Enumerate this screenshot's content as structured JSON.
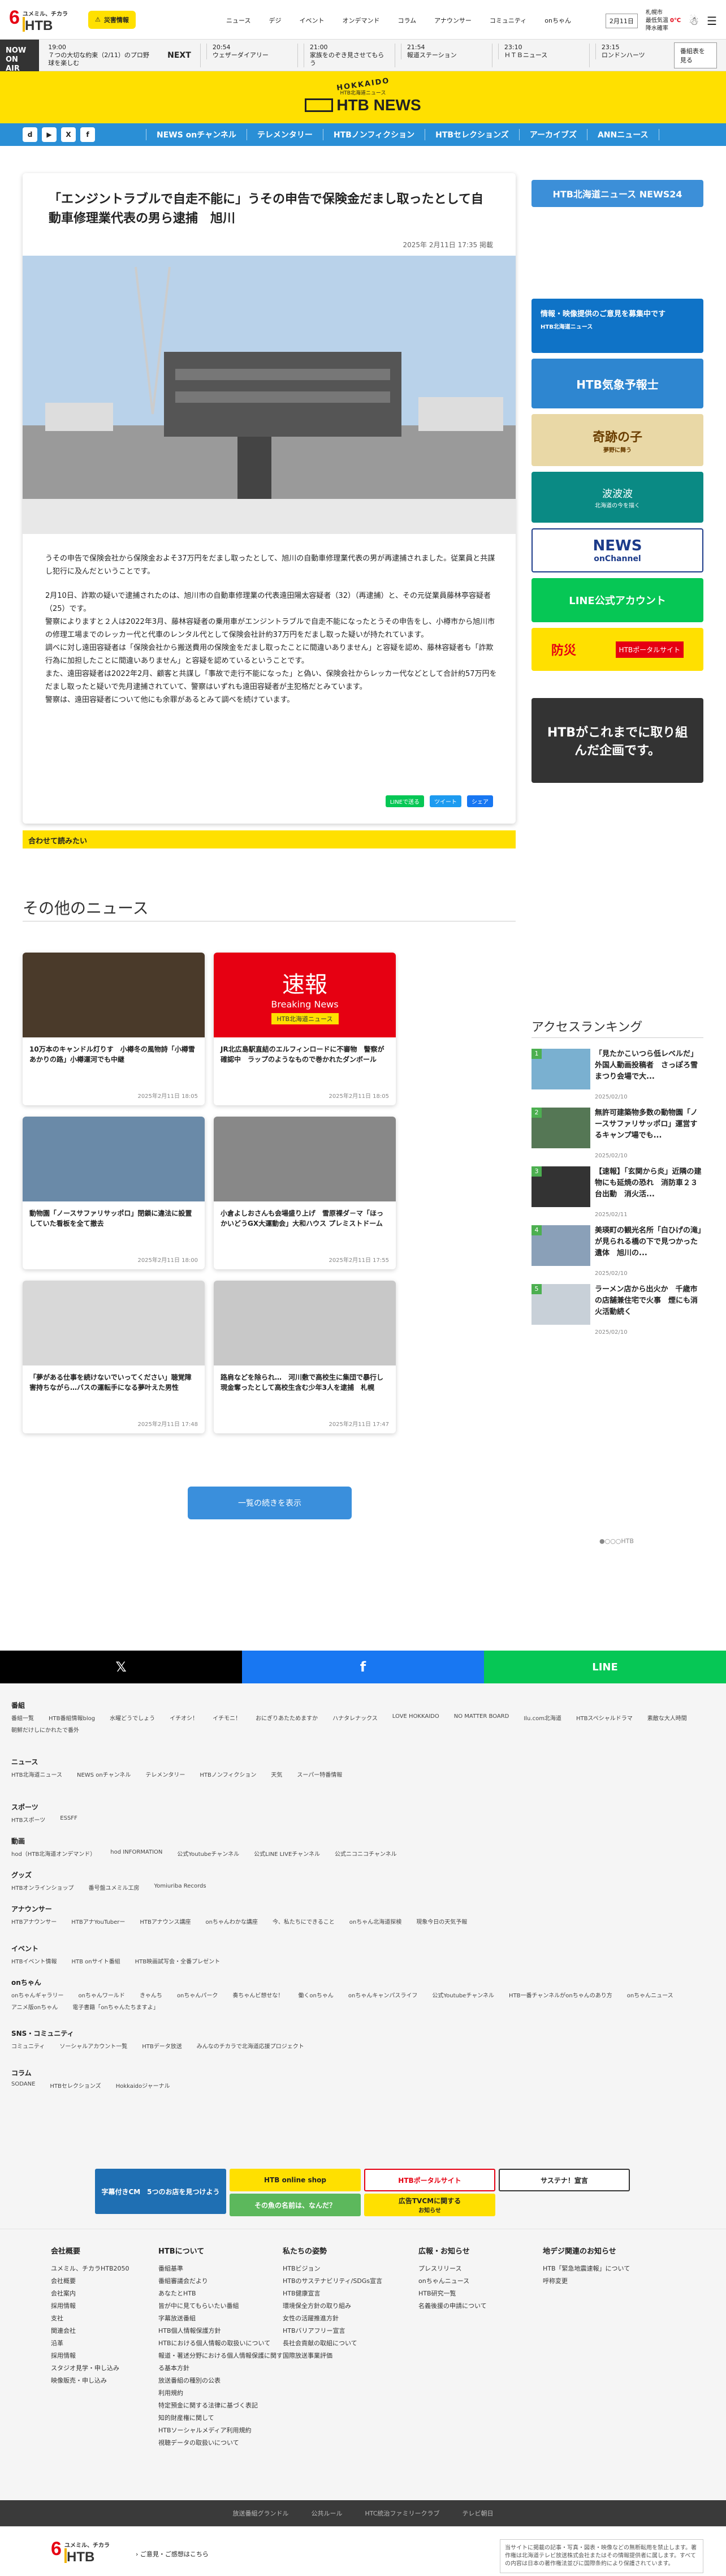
{
  "header": {
    "logo_six": "6",
    "logo_yume": "ユメミル、チカラ",
    "logo_htb": "HTB",
    "bousai": "災害情報",
    "nav": [
      "ニュース",
      "デジ",
      "イベント",
      "オンデマンド",
      "コラム",
      "アナウンサー",
      "コミュニティ",
      "onちゃん"
    ],
    "date": "2月11日",
    "weather_city": "札幌市",
    "weather_info": "最低気温",
    "weather_temp": "0℃",
    "weather_precip": "降水確率"
  },
  "onair": {
    "label": "NOW ON AIR",
    "now_time": "19:00",
    "now_title": "７つの大切な約束（2/11）のプロ野球を楽しむ",
    "next_label": "NEXT",
    "next": [
      {
        "time": "20:54",
        "title": "ウェザーダイアリー"
      },
      {
        "time": "21:00",
        "title": "家族をのぞき見させてもらう"
      },
      {
        "time": "21:54",
        "title": "報道ステーション"
      },
      {
        "time": "23:10",
        "title": "ＨＴＢニュース"
      },
      {
        "time": "23:15",
        "title": "ロンドンハーツ"
      }
    ],
    "program_button": "番組表を見る"
  },
  "banner": {
    "hokkaido": "HOKKAIDO",
    "sub": "HTB北海道ニュース",
    "title": "HTB NEWS"
  },
  "nav": {
    "social": [
      "d",
      "▶",
      "X",
      "f"
    ],
    "items": [
      "NEWS onチャンネル",
      "テレメンタリー",
      "HTBノンフィクション",
      "HTBセレクションズ",
      "アーカイブズ",
      "ANNニュース"
    ]
  },
  "article": {
    "title": "「エンジントラブルで自走不能に」うその申告で保険金だまし取ったとして自動車修理業代表の男ら逮捕　旭川",
    "date": "2025年 2月11日 17:35 掲載",
    "paragraphs": [
      "うその申告で保険会社から保険金およそ37万円をだまし取ったとして、旭川の自動車修理業代表の男が再逮捕されました。従業員と共謀し犯行に及んだということです。",
      "2月10日、詐欺の疑いで逮捕されたのは、旭川市の自動車修理業の代表遠田陽太容疑者（32）（再逮捕）と、その元従業員藤林亭容疑者（25）です。\n警察によりますと２人は2022年3月、藤林容疑者の乗用車がエンジントラブルで自走不能になったとうその申告をし、小樽市から旭川市の修理工場までのレッカー代と代車のレンタル代として保険会社計約37万円をだまし取った疑いが持たれています。\n調べに対し遠田容疑者は「保険会社から搬送費用の保険金をだまし取ったことに間違いありません」と容疑を認め、藤林容疑者も「詐欺行為に加担したことに間違いありません」と容疑を認めているということです。\nまた、遠田容疑者は2022年2月、顧客と共謀し「事故で走行不能になった」と偽い、保険会社からレッカー代などとして合計約57万円をだまし取ったと疑いで先月逮捕されていて、警察はいずれも遠田容疑者が主犯格だとみています。\n警察は、遠田容疑者について他にも余罪があるとみて調べを続けています。"
    ],
    "share": [
      "LINEで送る",
      "ツイート",
      "シェア"
    ]
  },
  "related_label": "合わせて読みたい",
  "other_title": "その他のニュース",
  "cards": [
    {
      "caption": "10万本のキャンドル灯りす　小樽冬の風物詩「小樽雪あかりの路」小樽運河でも中継",
      "date": "2025年2月11日 18:05"
    },
    {
      "caption": "JR北広島駅直結のエルフィンロードに不審物　警察が確認中　ラップのようなもので巻かれたダンボール",
      "date": "2025年2月11日 18:05",
      "badge": "速報",
      "badge_sub": "Breaking News",
      "badge_foot": "HTB北海道ニュース"
    },
    {
      "caption": "動物園「ノースサファリサッポロ」閉鎖に違法に設置していた看板を全て撤去",
      "date": "2025年2月11日 18:00"
    },
    {
      "caption": "小倉よしおさんも会場盛り上げ　雪原裸ダ－マ「ほっかいどうGX大運動会」大和ハウス プレミストドーム",
      "date": "2025年2月11日 17:55"
    },
    {
      "caption": "「夢がある仕事を続けないでいってください」聴覚障害持ちながら…バスの運転手になる夢叶えた男性",
      "date": "2025年2月11日 17:48"
    },
    {
      "caption": "路肩などを除られ…　河川敷で高校生に集団で暴行し現金奪ったとして高校生含む少年3人を逮捕　札幌",
      "date": "2025年2月11日 17:47"
    }
  ],
  "more_button": "一覧の続きを表示",
  "sidebar": {
    "news24": "HTB北海道ニュース NEWS24",
    "ad1": "情報・映像提供のご意見を募集中です",
    "ad1b": "HTB北海道ニュース",
    "ad2": "HTB気象予報士",
    "ad3": "奇跡の子",
    "ad3b": "夢野に舞う",
    "ad4": "波波波",
    "ad4b": "北海道の今を描く",
    "ad5": "NEWS",
    "ad5b": "onChannel",
    "ad6": "LINE公式アカウント",
    "ad7": "防災",
    "ad7b": "HTBポータルサイト",
    "ad8": "HTBがこれまでに取り組んだ企画です。"
  },
  "ranking": {
    "title": "アクセスランキング",
    "items": [
      {
        "title": "「見たかこいつら低レベルだ」外国人動画投稿者　さっぽろ雪まつり会場で大...",
        "date": "2025/02/10"
      },
      {
        "title": "無許可建築物多数の動物園「ノースサファリサッポロ」運営するキャンプ場でも...",
        "date": "2025/02/10"
      },
      {
        "title": "【速報】「玄関から炎」近隣の建物にも延焼の恐れ　消防車２３台出動　消火活...",
        "date": "2025/02/11"
      },
      {
        "title": "美瑛町の観光名所「白ひげの滝」が見られる橋の下で見つかった遺体　旭川の...",
        "date": "2025/02/10"
      },
      {
        "title": "ラーメン店から出火か　千歳市の店舗兼住宅で火事　煙にも消火活動続く",
        "date": "2025/02/10"
      }
    ]
  },
  "dots": "●○○○HTB",
  "sharebar": [
    "𝕏",
    "f",
    "LINE"
  ],
  "footer_sections": [
    {
      "title": "番組",
      "links": [
        "番組一覧",
        "HTB番組情報blog",
        "水曜どうでしょう",
        "イチオシ！",
        "イチモニ！",
        "おにぎりあたためますか",
        "ハナタレナックス",
        "LOVE HOKKAIDO",
        "NO MATTER BOARD",
        "Ilu.com北海道",
        "HTBスペシャルドラマ",
        "素敵な大人時間",
        "朝鮮だけしにかれたで番外"
      ]
    },
    {
      "title": "ニュース",
      "links": [
        "HTB北海道ニュース",
        "NEWS onチャンネル",
        "テレメンタリー",
        "HTBノンフィクション",
        "天気",
        "スーパー特番情報"
      ]
    },
    {
      "title": "スポーツ",
      "links": [
        "HTBスポーツ",
        "ESSFF"
      ]
    },
    {
      "title": "動画",
      "links": [
        "hod（HTB北海道オンデマンド）",
        "hod INFORMATION",
        "公式Youtubeチャンネル",
        "公式LINE LIVEチャンネル",
        "公式ニコニコチャンネル"
      ]
    },
    {
      "title": "グッズ",
      "links": [
        "HTBオンラインショップ",
        "番号盤ユメミル工房",
        "Yomiuriba Records"
      ]
    },
    {
      "title": "アナウンサー",
      "links": [
        "HTBアナウンサー",
        "HTBアナYouTuberー",
        "HTBアナウンス講座",
        "onちゃんわかな講座",
        "今、私たちにできること",
        "onちゃん北海道探検",
        "現象今日の天気予報"
      ]
    },
    {
      "title": "イベント",
      "links": [
        "HTBイベント情報",
        "HTB onサイト番組",
        "HTB映画試写会・全番プレゼント"
      ]
    },
    {
      "title": "onちゃん",
      "links": [
        "onちゃんギャラリー",
        "onちゃんワールド",
        "きゃんち",
        "onちゃんパーク",
        "奏ちゃんビ想せな！",
        "働くonちゃん",
        "onちゃんキャンパスライフ",
        "公式Youtubeチャンネル",
        "HTB一番チャンネルがonちゃんのあり方",
        "onちゃんニュース",
        "アニメ版onちゃん",
        "電子書籍「onちゃんたちますよ」"
      ]
    },
    {
      "title": "SNS・コミュニティ",
      "links": [
        "コミュニティ",
        "ソーシャルアカウント一覧",
        "HTBデータ放送",
        "みんなのチカラで北海道応援プロジェクト"
      ]
    },
    {
      "title": "コラム",
      "links": [
        "SODANE",
        "HTBセレクションズ",
        "Hokkaidoジャーナル"
      ]
    }
  ],
  "promo": [
    "字幕付きCM　5つのお店を見つけよう",
    "HTB online shop",
    "HTBポータルサイト",
    "サステナ！宣言",
    "その魚の名前は、なんだ？",
    "広告TVCMに関する",
    "お知らせ"
  ],
  "sitemap": [
    {
      "title": "会社概要",
      "links": [
        "ユメミル、チカラHTB2050",
        "会社概要",
        "会社案内",
        "採用情報",
        "支社",
        "関連会社",
        "沿革",
        "採用情報",
        "スタジオ見学・申し込み",
        "映像販売・申し込み"
      ]
    },
    {
      "title": "HTBについて",
      "links": [
        "番組基準",
        "番組審議会だより",
        "あなたとHTB",
        "皆が中に見てもらいたい番組",
        "字幕放送番組",
        "HTB個人情報保護方針",
        "HTBにおける個人情報の取扱いについて",
        "報道・著述分野における個人情報保護に関する基本方針",
        "放送番組の種別の公表",
        "利用規約",
        "特定預金に関する法律に基づく表記",
        "知的財産権に関して",
        "HTBソーシャルメディア利用規約",
        "視聴データの取扱いについて"
      ]
    },
    {
      "title": "私たちの姿勢",
      "links": [
        "HTBビジョン",
        "HTBのサステナビリティ/SDGs宣言",
        "HTB健康宣言",
        "環境保全方針の取り組み",
        "女性の活躍推進方針",
        "HTBバリアフリー宣言",
        "長社会貢献の取組について",
        "国際放送事業評価"
      ]
    },
    {
      "title": "広報・お知らせ",
      "links": [
        "プレスリリース",
        "onちゃんニュース",
        "HTB研究一覧",
        "名義後援の申請について"
      ]
    },
    {
      "title": "地デジ関連のお知らせ",
      "links": [
        "HTB「緊急地震速報」について",
        "呼称変更"
      ]
    }
  ],
  "bottom_links": [
    "放送番組グランドル",
    "公共ルール",
    "HTC統治ファミリークラブ",
    "テレビ朝日"
  ],
  "footer_logo_links": "ご意見・ご感想はこちら",
  "copyright": "当サイトに掲載の記事・写真・図表・映像などの無断転用を禁止します。著作権は北海道テレビ放送株式会社またはその情報提供者に属します。すべての内容は日本の著作権法並びに国際条約により保護されています。"
}
